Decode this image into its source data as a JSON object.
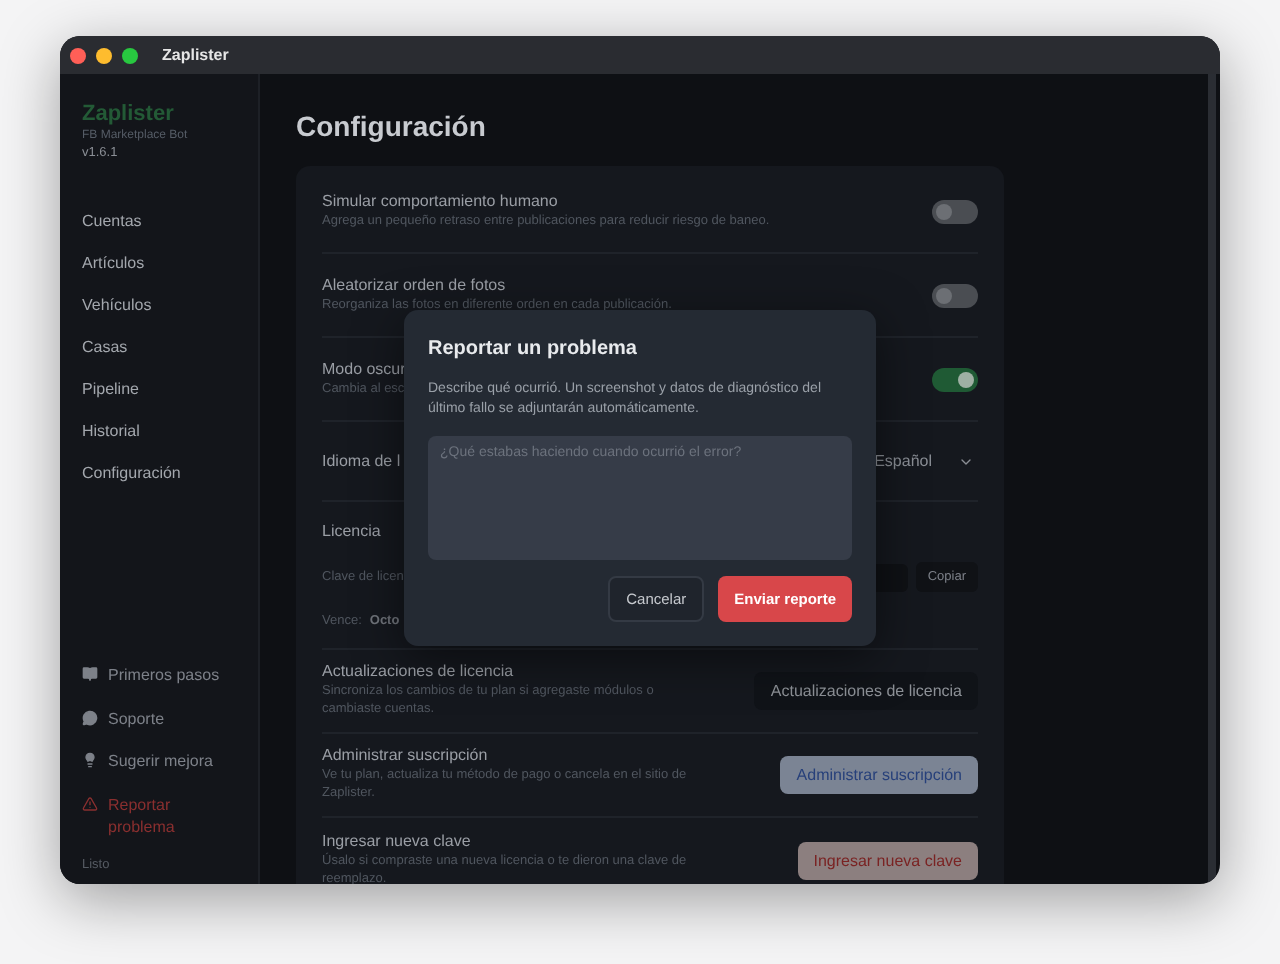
{
  "window": {
    "title": "Zaplister"
  },
  "sidebar": {
    "brand": "Zaplister",
    "subtitle": "FB Marketplace Bot",
    "version": "v1.6.1",
    "nav": [
      "Cuentas",
      "Artículos",
      "Vehículos",
      "Casas",
      "Pipeline",
      "Historial",
      "Configuración"
    ],
    "links": [
      {
        "kind": "book",
        "label": "Primeros pasos"
      },
      {
        "kind": "chat",
        "label": "Soporte"
      },
      {
        "kind": "bulb",
        "label": "Sugerir mejora"
      },
      {
        "kind": "warning",
        "label": "Reportar problema"
      }
    ],
    "status": "Listo"
  },
  "main": {
    "heading": "Configuración",
    "settings": [
      {
        "kind": "toggle",
        "title": "Simular comportamiento humano",
        "description": "Agrega un pequeño retraso entre publicaciones para reducir riesgo de baneo.",
        "on": false
      },
      {
        "kind": "toggle",
        "title": "Aleatorizar orden de fotos",
        "description": "Reorganiza las fotos en diferente orden en cada publicación.",
        "on": false
      },
      {
        "kind": "toggle",
        "title": "Modo oscur",
        "description": "Cambia al esc",
        "on": true
      },
      {
        "kind": "select",
        "title": "Idioma de l",
        "value": "Español"
      },
      {
        "kind": "license",
        "title": "Licencia",
        "key_label": "Clave de licen",
        "copy": "Copiar",
        "expires_label": "Vence:",
        "expires_value": "Octo"
      },
      {
        "kind": "button",
        "title": "Actualizaciones de licencia",
        "description": "Sincroniza los cambios de tu plan si agregaste módulos o cambiaste cuentas.",
        "button": {
          "label": "Actualizaciones de licencia",
          "kind": "dark"
        }
      },
      {
        "kind": "button",
        "title": "Administrar suscripción",
        "description": "Ve tu plan, actualiza tu método de pago o cancela en el sitio de Zaplister.",
        "button": {
          "label": "Administrar suscripción",
          "kind": "info"
        }
      },
      {
        "kind": "button",
        "title": "Ingresar nueva clave",
        "description": "Úsalo si compraste una nueva licencia o te dieron una clave de reemplazo.",
        "button": {
          "label": "Ingresar nueva clave",
          "kind": "danger"
        }
      }
    ]
  },
  "dialog": {
    "title": "Reportar un problema",
    "description": "Describe qué ocurrió. Un screenshot y datos de diagnóstico del último fallo se adjuntarán automáticamente.",
    "placeholder": "¿Qué estabas haciendo cuando ocurrió el error?",
    "buttons": [
      {
        "label": "Cancelar",
        "kind": "secondary"
      },
      {
        "label": "Enviar reporte",
        "kind": "primary"
      }
    ]
  }
}
